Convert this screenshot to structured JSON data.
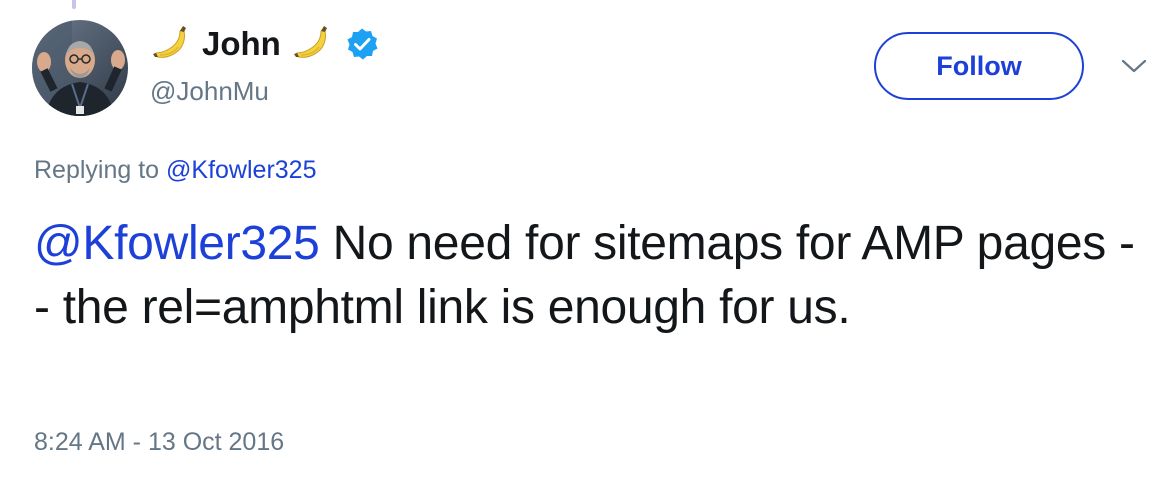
{
  "profile": {
    "display_name": "John",
    "handle": "@JohnMu",
    "verified": true,
    "name_decoration_icon": "banana-emoji-icon",
    "verified_icon": "verified-badge-icon"
  },
  "actions": {
    "follow_label": "Follow",
    "more_icon": "chevron-down-icon"
  },
  "reply": {
    "prefix": "Replying to",
    "to_handle": "@Kfowler325"
  },
  "tweet": {
    "mention": "@Kfowler325",
    "body": " No need for sitemaps for AMP pages -- the rel=amphtml link is enough for us."
  },
  "meta": {
    "timestamp": "8:24 AM - 13 Oct 2016"
  },
  "colors": {
    "link_blue": "#1d41d8",
    "secondary_text": "#657786",
    "primary_text": "#14171a",
    "verified_blue": "#1da1f2"
  }
}
